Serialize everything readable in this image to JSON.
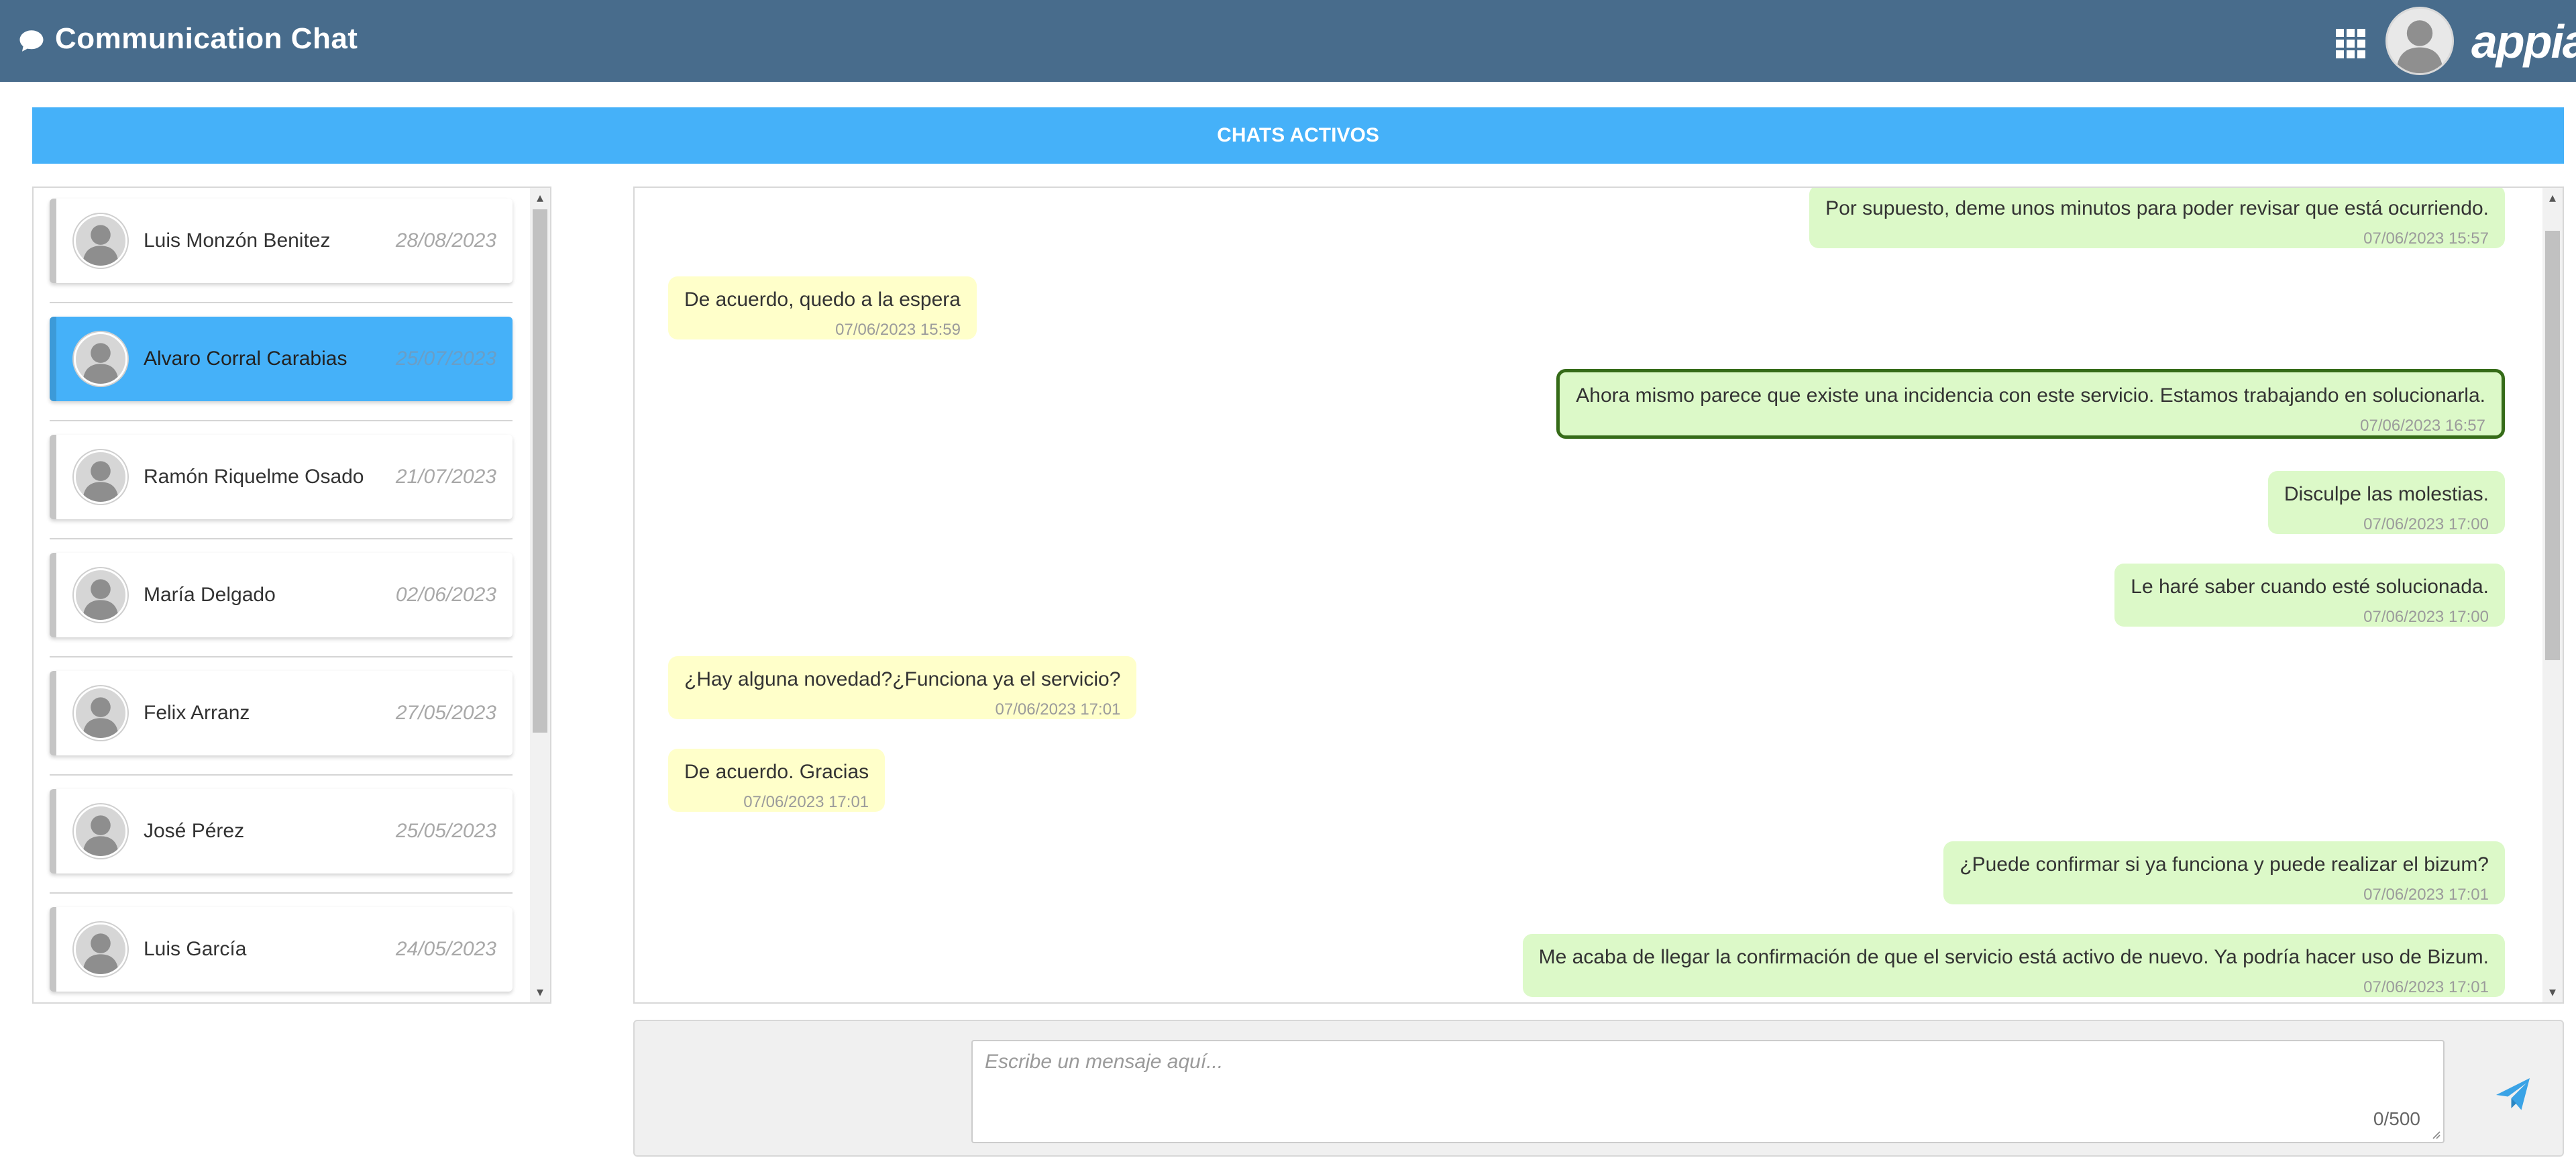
{
  "header": {
    "title": "Communication Chat",
    "logo_text": "appian",
    "chat_icon": "chat-bubble-icon",
    "apps_icon": "grid-icon"
  },
  "banner": {
    "title": "CHATS ACTIVOS"
  },
  "contacts": [
    {
      "name": "Luis Monzón Benitez",
      "date": "28/08/2023",
      "active": false
    },
    {
      "name": "Alvaro Corral Carabias",
      "date": "25/07/2023",
      "active": true
    },
    {
      "name": "Ramón Riquelme Osado",
      "date": "21/07/2023",
      "active": false
    },
    {
      "name": "María Delgado",
      "date": "02/06/2023",
      "active": false
    },
    {
      "name": "Felix Arranz",
      "date": "27/05/2023",
      "active": false
    },
    {
      "name": "José Pérez",
      "date": "25/05/2023",
      "active": false
    },
    {
      "name": "Luis García",
      "date": "24/05/2023",
      "active": false
    }
  ],
  "messages": [
    {
      "text": "Por supuesto, deme unos minutos para poder revisar que está ocurriendo.",
      "time": "07/06/2023 15:57",
      "direction": "out"
    },
    {
      "text": "De acuerdo, quedo a la espera",
      "time": "07/06/2023 15:59",
      "direction": "in"
    },
    {
      "text": "Ahora mismo parece que existe una incidencia con este servicio. Estamos trabajando en solucionarla.",
      "time": "07/06/2023 16:57",
      "direction": "out",
      "highlighted": true
    },
    {
      "text": "Disculpe las molestias.",
      "time": "07/06/2023 17:00",
      "direction": "out"
    },
    {
      "text": "Le haré saber cuando esté solucionada.",
      "time": "07/06/2023 17:00",
      "direction": "out"
    },
    {
      "text": "¿Hay alguna novedad?¿Funciona ya el servicio?",
      "time": "07/06/2023 17:01",
      "direction": "in"
    },
    {
      "text": "De acuerdo. Gracias",
      "time": "07/06/2023 17:01",
      "direction": "in"
    },
    {
      "text": "¿Puede confirmar si ya funciona y puede realizar el bizum?",
      "time": "07/06/2023 17:01",
      "direction": "out"
    },
    {
      "text": "Me acaba de llegar la confirmación de que el servicio está activo de nuevo. Ya podría hacer uso de Bizum.",
      "time": "07/06/2023 17:01",
      "direction": "out"
    }
  ],
  "composer": {
    "placeholder": "Escribe un mensaje aquí...",
    "counter": "0/500",
    "send_icon": "send-icon"
  },
  "colors": {
    "header": "#486c8c",
    "accent": "#45b1f9",
    "incoming_bubble": "#ffffca",
    "outgoing_bubble": "#dcf9c8",
    "highlight_border": "#356b18"
  }
}
